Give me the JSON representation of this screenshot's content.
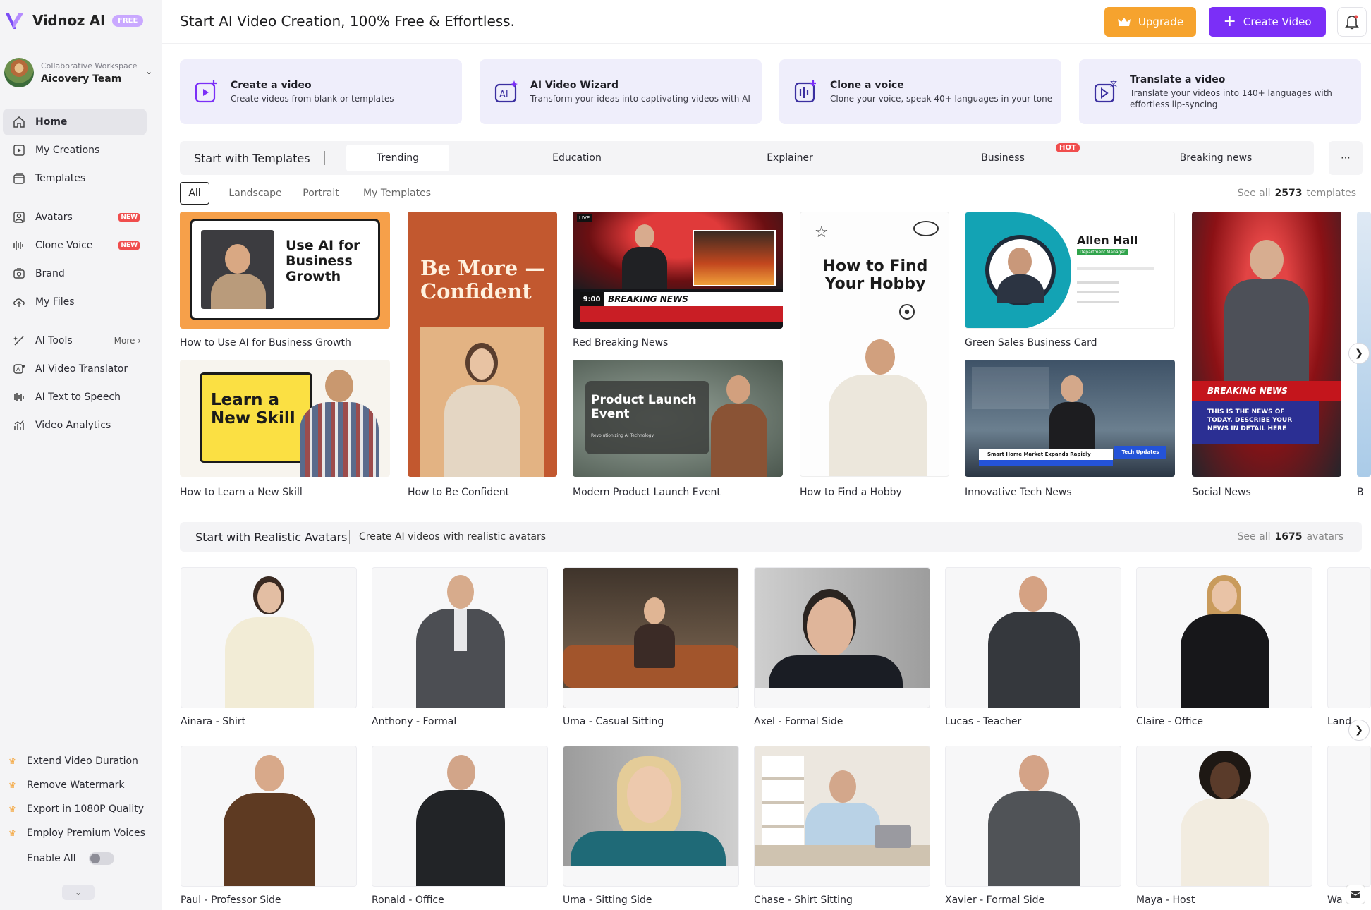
{
  "brand": {
    "name": "Vidnoz AI",
    "badge": "FREE"
  },
  "workspace": {
    "label": "Collaborative Workspace",
    "name": "Aicovery Team"
  },
  "nav": {
    "home": "Home",
    "my_creations": "My Creations",
    "templates": "Templates",
    "avatars": "Avatars",
    "clone_voice": "Clone Voice",
    "brand": "Brand",
    "my_files": "My Files",
    "ai_tools": "AI Tools",
    "more": "More",
    "ai_video_translator": "AI Video Translator",
    "ai_text_to_speech": "AI Text to Speech",
    "video_analytics": "Video Analytics",
    "new_badge": "NEW"
  },
  "upsell": {
    "items": [
      "Extend Video Duration",
      "Remove Watermark",
      "Export in 1080P Quality",
      "Employ Premium Voices"
    ],
    "enable_all": "Enable All"
  },
  "header": {
    "title": "Start AI Video Creation, 100% Free & Effortless.",
    "upgrade": "Upgrade",
    "create_video": "Create Video"
  },
  "quick_actions": [
    {
      "title": "Create a video",
      "desc": "Create videos from blank or templates"
    },
    {
      "title": "AI Video Wizard",
      "desc": "Transform your ideas into captivating videos with AI"
    },
    {
      "title": "Clone a voice",
      "desc": "Clone your voice, speak 40+ languages in your tone"
    },
    {
      "title": "Translate a video",
      "desc": "Translate your videos into 140+ languages with effortless lip-syncing"
    }
  ],
  "templates": {
    "section_title": "Start with Templates",
    "tabs": [
      "Trending",
      "Education",
      "Explainer",
      "Business",
      "Breaking news"
    ],
    "hot_badge": "HOT",
    "filters": [
      "All",
      "Landscape",
      "Portrait",
      "My Templates"
    ],
    "see_all_prefix": "See all",
    "count": "2573",
    "see_all_suffix": "templates",
    "items": [
      "How to Use AI for Business Growth",
      "How to Learn a New Skill",
      "How to Be Confident",
      "Red Breaking News",
      "Modern Product Launch Event",
      "How to Find a Hobby",
      "Green Sales Business Card",
      "Innovative Tech News",
      "Social News",
      "B"
    ],
    "thumb_text": {
      "business_growth": "Use AI for Business Growth",
      "learn_skill": "Learn a New Skill",
      "confident": "Be More — Confident",
      "breaking_news": "BREAKING NEWS",
      "breaking_time": "9:00",
      "live": "LIVE",
      "product_launch": "Product Launch Event",
      "product_sub": "Revolutionizing AI Technology",
      "hobby": "How to Find Your Hobby",
      "card_name": "Allen Hall",
      "card_role": "Department Manager",
      "tech_ticker": "Smart Home Market Expands Rapidly",
      "tech_tag": "Tech Updates",
      "social_breaking": "BREAKING NEWS",
      "social_text": "THIS IS THE NEWS OF TODAY. DESCRIBE YOUR NEWS IN DETAIL HERE"
    }
  },
  "avatars": {
    "section_title": "Start with Realistic Avatars",
    "subtitle": "Create AI videos with realistic avatars",
    "see_all_prefix": "See all",
    "count": "1675",
    "see_all_suffix": "avatars",
    "row1": [
      "Ainara - Shirt",
      "Anthony - Formal",
      "Uma - Casual Sitting",
      "Axel - Formal Side",
      "Lucas - Teacher",
      "Claire - Office",
      "Land"
    ],
    "row2": [
      "Paul - Professor Side",
      "Ronald - Office",
      "Uma - Sitting Side",
      "Chase - Shirt Sitting",
      "Xavier - Formal Side",
      "Maya - Host",
      "Wa"
    ]
  },
  "colors": {
    "accent_purple": "#7b2ff7",
    "upgrade_orange": "#f6a32e",
    "new_red": "#f04d4d",
    "card_lavender": "#efeefb"
  }
}
